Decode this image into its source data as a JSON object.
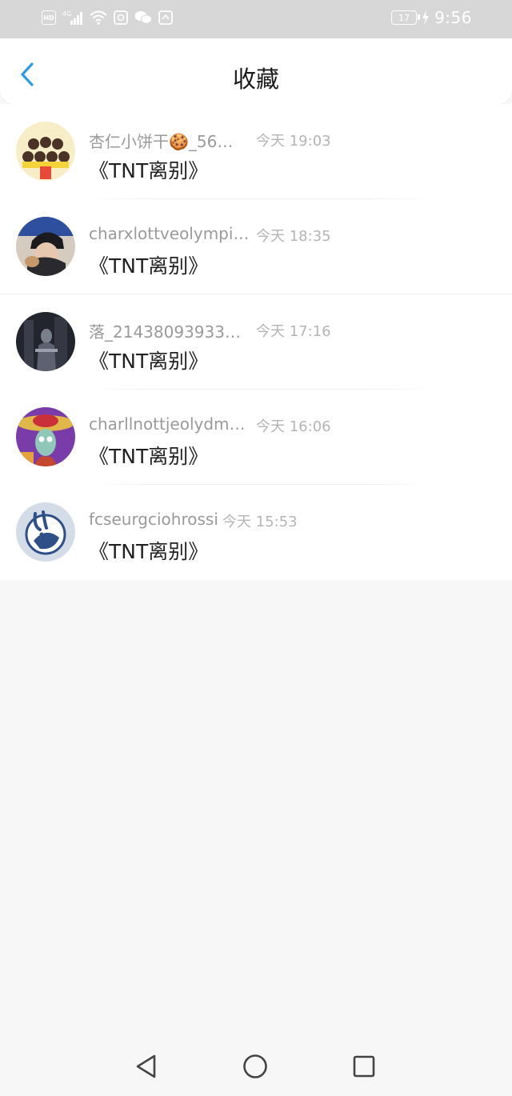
{
  "status_bar": {
    "left_icons": [
      "hd-icon",
      "signal-4g-icon",
      "wifi-icon",
      "app-icon",
      "wechat-icon",
      "app-badge-icon"
    ],
    "network_label": "4G",
    "hd_label": "HD",
    "battery_level": "17",
    "time": "9:56"
  },
  "header": {
    "title": "收藏",
    "back_icon": "chevron-left-icon",
    "accent_color": "#2a9de8"
  },
  "favorites": [
    {
      "name": "杏仁小饼干🍪_56…",
      "time": "今天 19:03",
      "message": "《TNT离别》"
    },
    {
      "name": "charxlottveolympi…",
      "time": "今天 18:35",
      "message": "《TNT离别》"
    },
    {
      "name": "落_21438093933…",
      "time": "今天 17:16",
      "message": "《TNT离别》"
    },
    {
      "name": "charllnottjeolydm…",
      "time": "今天 16:06",
      "message": "《TNT离别》"
    },
    {
      "name": "fcseurgciohrossi",
      "time": "今天 15:53",
      "message": "《TNT离别》"
    }
  ],
  "nav_bar": {
    "buttons": [
      "back-triangle-icon",
      "home-circle-icon",
      "recents-square-icon"
    ]
  }
}
